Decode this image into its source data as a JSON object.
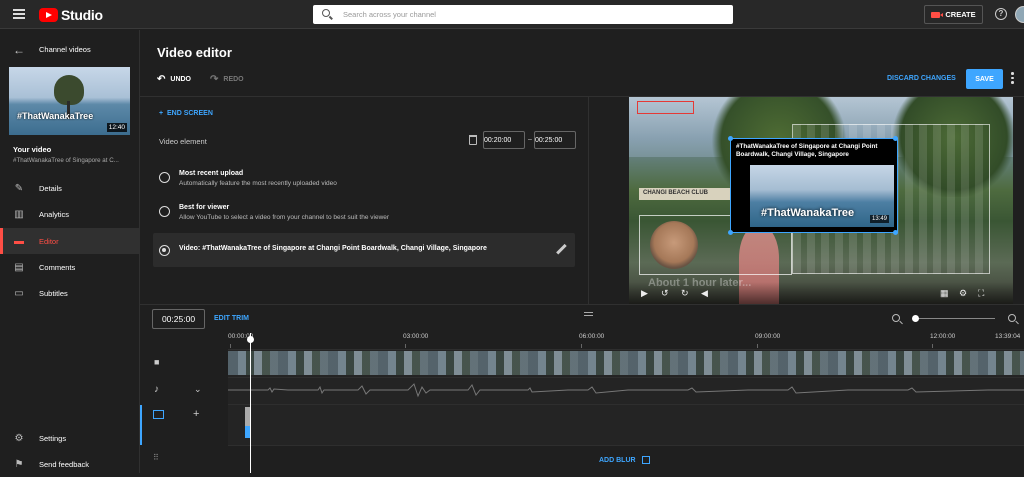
{
  "topbar": {
    "brand": "Studio",
    "search_placeholder": "Search across your channel",
    "create_label": "CREATE",
    "help_icon_glyph": "?"
  },
  "sidebar": {
    "back_label": "Channel videos",
    "thumbnail": {
      "overlay_text": "#ThatWanakaTree",
      "duration": "12:40"
    },
    "your_video_label": "Your video",
    "video_title": "#ThatWanakaTree of Singapore at C...",
    "items": [
      {
        "label": "Details",
        "icon": "pencil-icon"
      },
      {
        "label": "Analytics",
        "icon": "analytics-icon"
      },
      {
        "label": "Editor",
        "icon": "editor-icon",
        "active": true
      },
      {
        "label": "Comments",
        "icon": "comments-icon"
      },
      {
        "label": "Subtitles",
        "icon": "subtitles-icon"
      }
    ],
    "bottom_items": [
      {
        "label": "Settings",
        "icon": "gear-icon"
      },
      {
        "label": "Send feedback",
        "icon": "feedback-icon"
      }
    ]
  },
  "editor": {
    "title": "Video editor",
    "undo_label": "UNDO",
    "redo_label": "REDO",
    "discard_label": "DISCARD CHANGES",
    "save_label": "SAVE"
  },
  "endscreen": {
    "add_label": "END SCREEN",
    "element_label": "Video element",
    "start_time": "00:20:00",
    "end_time": "00:25:00",
    "options": [
      {
        "title": "Most recent upload",
        "desc": "Automatically feature the most recently uploaded video",
        "selected": false
      },
      {
        "title": "Best for viewer",
        "desc": "Allow YouTube to select a video from your channel to best suit the viewer",
        "selected": false
      },
      {
        "title": "Video: #ThatWanakaTree of Singapore at Changi Point Boardwalk, Changi Village, Singapore",
        "desc": "",
        "selected": true
      }
    ]
  },
  "preview": {
    "sign_text": "CHANGI BEACH CLUB",
    "card_title": "#ThatWanakaTree of Singapore at Changi Point Boardwalk, Changi Village, Singapore",
    "card_tag": "#ThatWanakaTree",
    "card_duration": "13:49",
    "card_footer": "#ThatWanakaTree of Singapore at Changi Point Boardwalk",
    "overlay_text": "About 1 hour later..."
  },
  "timeline": {
    "current_time": "00:25:00",
    "edit_trim_label": "EDIT TRIM",
    "ruler": [
      "00:00:00",
      "03:00:00",
      "06:00:00",
      "09:00:00",
      "12:00:00",
      "13:39:04"
    ],
    "add_blur_label": "ADD BLUR"
  },
  "colors": {
    "accent_blue": "#3ea6ff",
    "active_red": "#ff4e45",
    "youtube_red": "#ff0000",
    "background": "#1f1f1f"
  }
}
